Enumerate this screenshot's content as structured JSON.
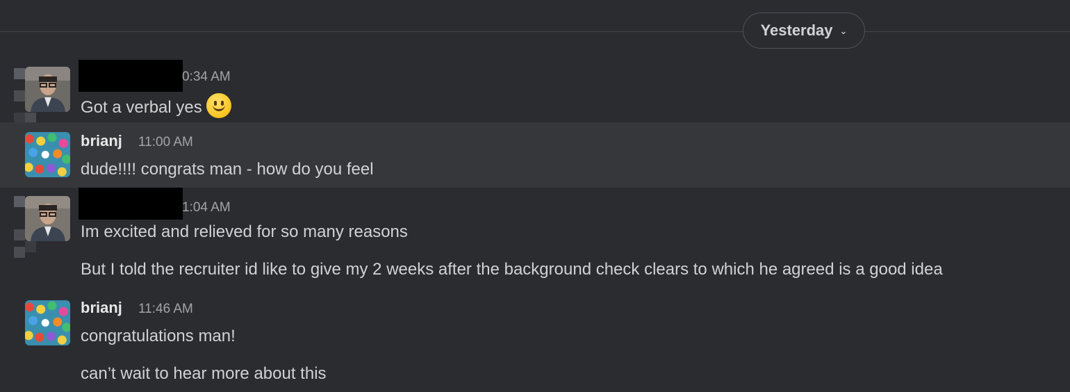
{
  "day_divider": {
    "label": "Yesterday",
    "chevron_icon": "chevron-down-icon"
  },
  "messages": [
    {
      "author": "",
      "time": "0:34 AM",
      "lines": [
        "Got a verbal yes"
      ],
      "emoji": "slightly-smiling-face"
    },
    {
      "author": "brianj",
      "time": "11:00 AM",
      "lines": [
        "dude!!!! congrats man - how do you feel"
      ]
    },
    {
      "author": "",
      "time": "1:04 AM",
      "lines": [
        "Im excited and relieved for so many reasons",
        "But I told the recruiter id like to give my 2 weeks after the background check clears to which he agreed is a good idea"
      ]
    },
    {
      "author": "brianj",
      "time": "11:46 AM",
      "lines": [
        "congratulations man!",
        "can’t wait to hear more about this"
      ]
    }
  ],
  "colors": {
    "background": "#2b2c30",
    "hover_row": "#36373b",
    "text": "#d1d2d3",
    "timestamp": "#a3a4a7"
  }
}
